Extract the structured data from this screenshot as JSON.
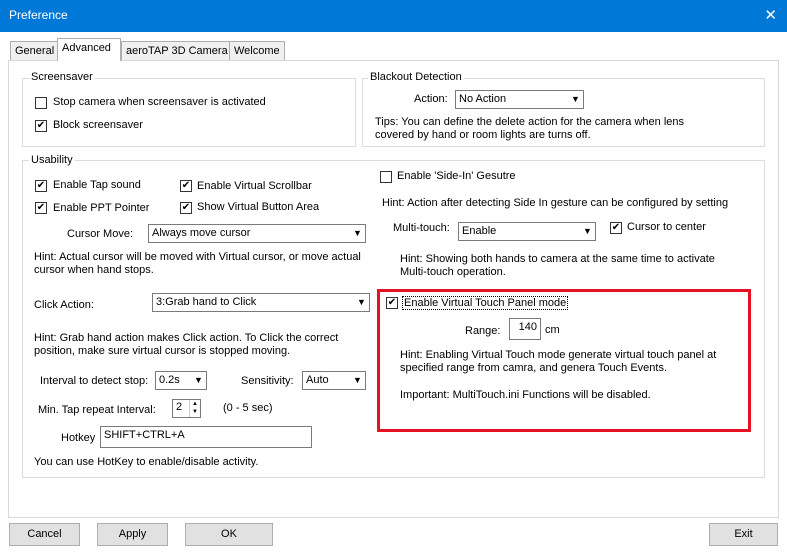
{
  "window": {
    "title": "Preference",
    "close_glyph": "✕"
  },
  "tabs": [
    "General",
    "Advanced",
    "aeroTAP 3D Camera",
    "Welcome"
  ],
  "screensaver": {
    "title": "Screensaver",
    "stop_camera": {
      "label": "Stop camera when screensaver is activated",
      "checked": false
    },
    "block": {
      "label": "Block screensaver",
      "checked": true
    }
  },
  "blackout": {
    "title": "Blackout Detection",
    "action_label": "Action:",
    "action_value": "No Action",
    "tips": [
      "Tips: You can define the delete action for the camera when lens",
      "covered by hand or room lights are turns off."
    ]
  },
  "usability": {
    "title": "Usability",
    "tap_sound": {
      "label": "Enable Tap sound",
      "checked": true
    },
    "virtual_scrollbar": {
      "label": "Enable Virtual Scrollbar",
      "checked": true
    },
    "ppt_pointer": {
      "label": "Enable PPT Pointer",
      "checked": true
    },
    "virtual_button": {
      "label": "Show Virtual Button Area",
      "checked": true
    },
    "cursor_move_label": "Cursor Move:",
    "cursor_move_value": "Always move cursor",
    "hint1": [
      "Hint: Actual cursor will be moved with Virtual cursor, or move actual",
      "cursor when hand stops."
    ],
    "click_action_label": "Click Action:",
    "click_action_value": "3:Grab hand to Click",
    "hint2": [
      "Hint: Grab hand action makes Click action. To Click the correct",
      "position, make sure virtual cursor is stopped moving."
    ],
    "interval_label": "Interval to detect stop:",
    "interval_value": "0.2s",
    "sensitivity_label": "Sensitivity:",
    "sensitivity_value": "Auto",
    "tap_repeat_label": "Min. Tap repeat Interval:",
    "tap_repeat_value": "2",
    "tap_repeat_range": "(0 - 5 sec)",
    "hotkey_label": "Hotkey",
    "hotkey_value": "SHIFT+CTRL+A",
    "hotkey_hint": "You can use HotKey to enable/disable activity.",
    "side_in": {
      "label": "Enable 'Side-In' Gesutre",
      "checked": false
    },
    "side_in_hint": "Hint: Action after detecting Side In gesture can be configured by setting",
    "multitouch_label": "Multi-touch:",
    "multitouch_value": "Enable",
    "cursor_center": {
      "label": "Cursor to center",
      "checked": true
    },
    "multitouch_hint": [
      "Hint: Showing both hands to camera at the same time to activate",
      "Multi-touch operation."
    ],
    "vtp": {
      "label": "Enable Virtual Touch Panel mode",
      "checked": true
    },
    "range_label": "Range:",
    "range_value": "140",
    "range_unit": "cm",
    "vtp_hint": [
      "Hint: Enabling Virtual Touch mode generate virtual touch panel at",
      "specified range from camra,  and genera Touch Events."
    ],
    "vtp_important": "Important: MultiTouch.ini Functions will be disabled."
  },
  "buttons": {
    "cancel": "Cancel",
    "apply": "Apply",
    "ok": "OK",
    "exit": "Exit"
  },
  "colors": {
    "titlebar": "#0078d7",
    "highlight_box": "#e81123"
  }
}
